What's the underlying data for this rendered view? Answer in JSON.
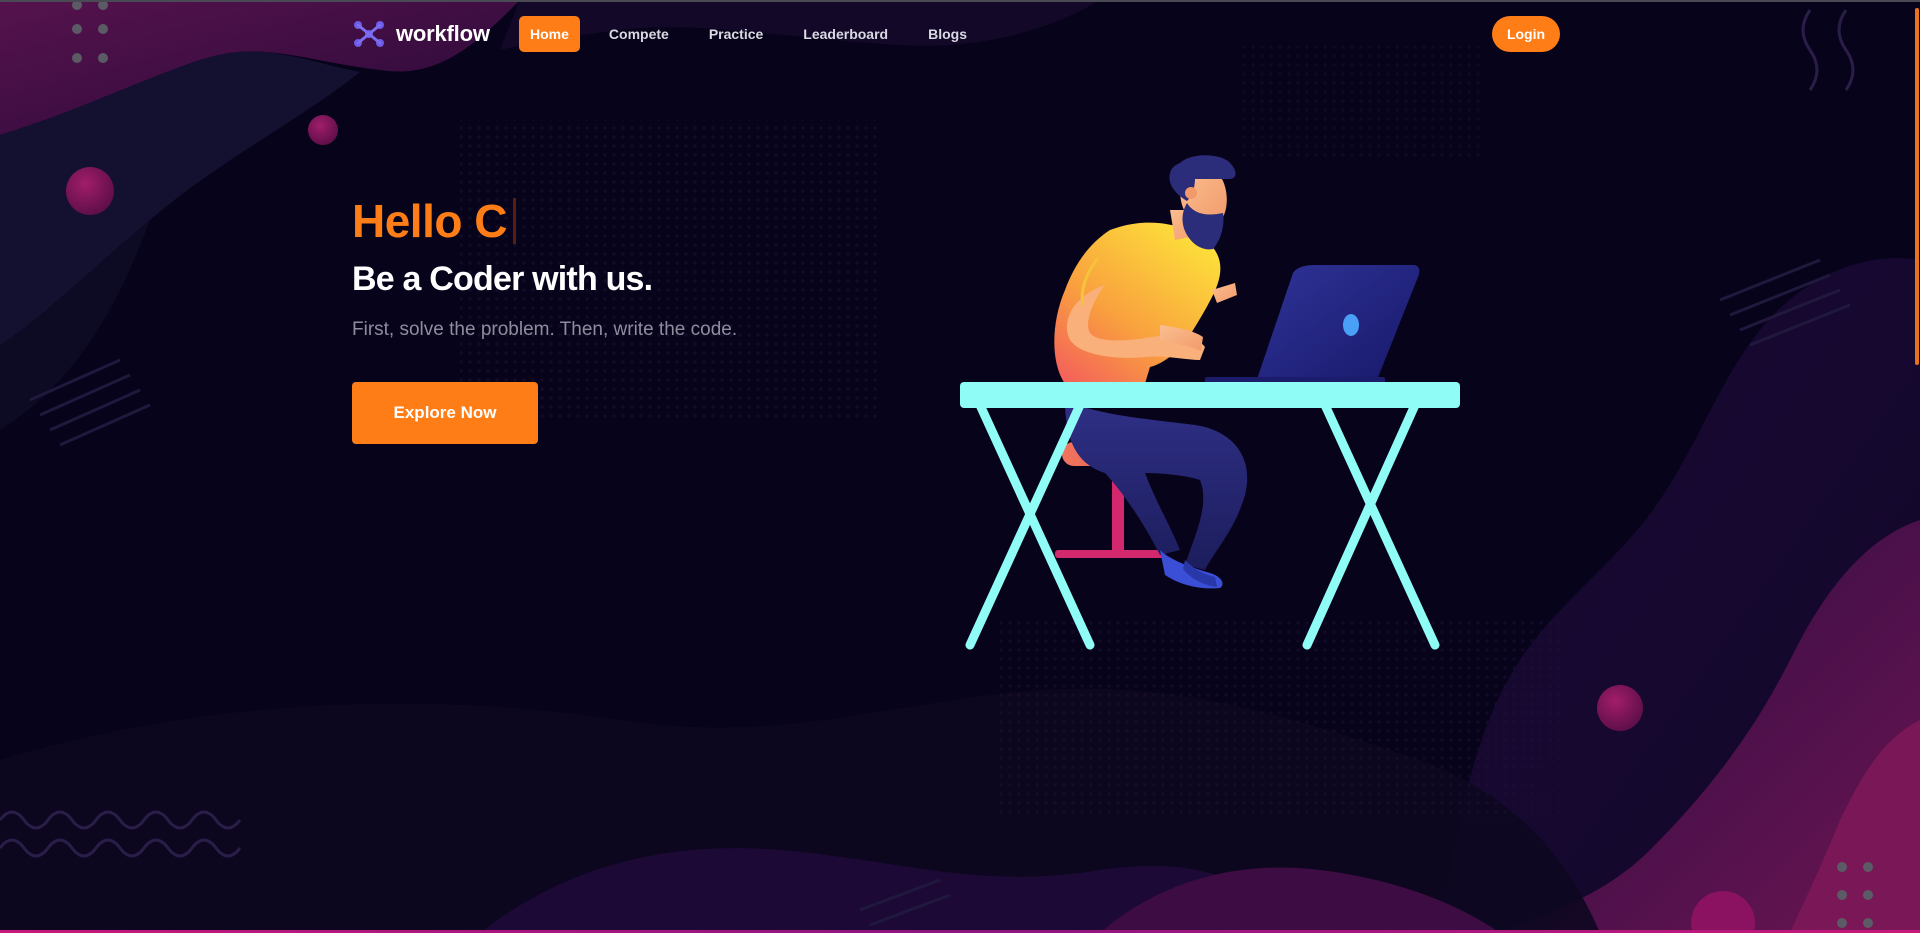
{
  "brand": {
    "name": "workflow",
    "logo_icon": "workflow-logo-icon"
  },
  "nav": {
    "items": [
      {
        "label": "Home",
        "active": true
      },
      {
        "label": "Compete",
        "active": false
      },
      {
        "label": "Practice",
        "active": false
      },
      {
        "label": "Leaderboard",
        "active": false
      },
      {
        "label": "Blogs",
        "active": false
      }
    ],
    "login_label": "Login"
  },
  "hero": {
    "greeting": "Hello C",
    "tagline": "Be a Coder with us.",
    "subtitle": "First, solve the problem. Then, write the code.",
    "cta_label": "Explore Now",
    "illustration": "coder-at-desk-illustration"
  },
  "colors": {
    "background": "#07031a",
    "accent": "#fe7d17",
    "blob_magenta": "#4a0f43",
    "blob_purple": "#1f0b3d",
    "desk": "#8ffcf5",
    "shirt_top": "#fde23a",
    "shirt_bottom": "#f56a5c",
    "pants": "#2a2d7d",
    "laptop": "#2b2f8f"
  }
}
